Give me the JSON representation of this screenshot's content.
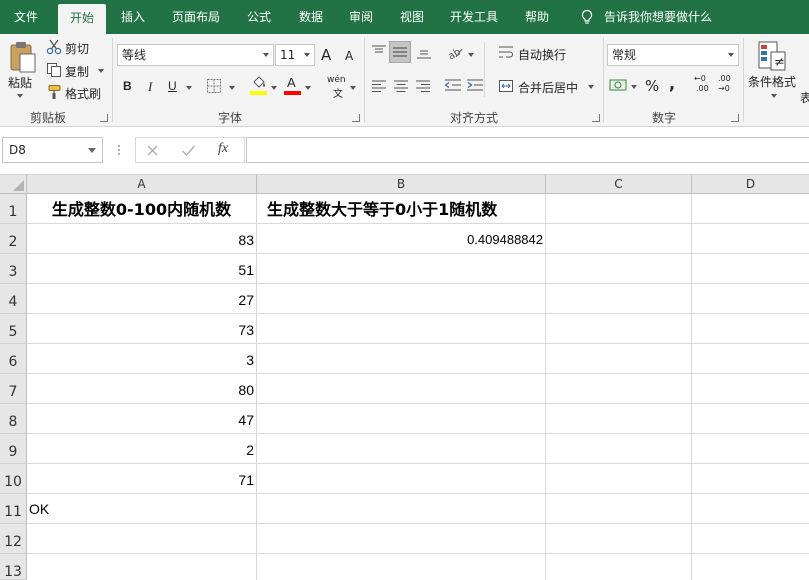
{
  "tabs": [
    {
      "label": "文件"
    },
    {
      "label": "开始"
    },
    {
      "label": "插入"
    },
    {
      "label": "页面布局"
    },
    {
      "label": "公式"
    },
    {
      "label": "数据"
    },
    {
      "label": "审阅"
    },
    {
      "label": "视图"
    },
    {
      "label": "开发工具"
    },
    {
      "label": "帮助"
    }
  ],
  "tell_me": "告诉我你想要做什么",
  "clipboard": {
    "paste": "粘贴",
    "cut": "剪切",
    "copy": "复制",
    "format_painter": "格式刷",
    "group_label": "剪贴板"
  },
  "font": {
    "name": "等线",
    "size": "11",
    "grow": "A",
    "shrink": "A",
    "bold": "B",
    "italic": "I",
    "underline": "U",
    "font_color": "A",
    "phonetic": "wén",
    "phonetic_sub": "文",
    "group_label": "字体"
  },
  "alignment": {
    "wrap_text": "自动换行",
    "merge_center": "合并后居中",
    "group_label": "对齐方式"
  },
  "number": {
    "format": "常规",
    "percent": "%",
    "comma": ",",
    "inc_decimal_a": "←0",
    "inc_decimal_b": ".00",
    "dec_decimal_a": ".00",
    "dec_decimal_b": "→0",
    "group_label": "数字"
  },
  "styles": {
    "conditional_format": "条件格式",
    "partial": "表"
  },
  "formula_bar": {
    "name_box": "D8",
    "fx": "fx",
    "formula": ""
  },
  "columns": [
    "A",
    "B",
    "C",
    "D"
  ],
  "rows": [
    "1",
    "2",
    "3",
    "4",
    "5",
    "6",
    "7",
    "8",
    "9",
    "10",
    "11",
    "12",
    "13"
  ],
  "cells": {
    "A1": "生成整数0-100内随机数",
    "B1": "生成整数大于等于0小于1随机数",
    "A2": "83",
    "B2": "0.409488842",
    "A3": "51",
    "A4": "27",
    "A5": "73",
    "A6": "3",
    "A7": "80",
    "A8": "47",
    "A9": "2",
    "A10": "71",
    "A11": "OK"
  },
  "colors": {
    "accent": "#217346",
    "highlight_yellow": "#ffff00",
    "font_red": "#ff0000"
  }
}
